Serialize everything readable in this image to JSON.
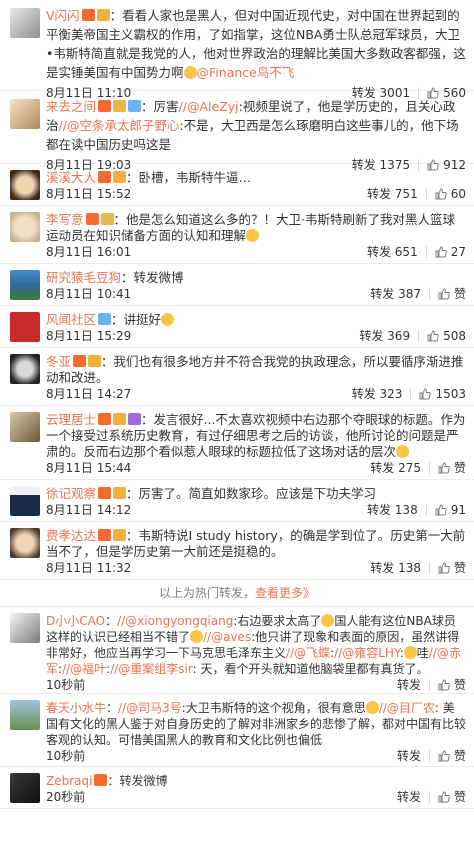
{
  "comments": [
    {
      "user": "V闪闪",
      "text": "：看看人家也是黑人，但对中国近现代史，对中国在世界起到的平衡美帝国主义霸权的作用，了如指掌，这位NBA勇士队总冠军球员，大卫•韦斯特简直就是我党的人，他对世界政治的理解比美国大多数政客都强，这是实锤美国有中国势力啊",
      "tail": "@Finance鸟不飞",
      "time": "8月11日 11:10",
      "repost": "转发 3001",
      "likes": "560"
    },
    {
      "user": "来去之间",
      "pre": "：厉害",
      "m1": "//@AleZyj",
      "t1": ":视频里说了，他是学历史的，且关心政治",
      "m2": "//@空条承太郎子野心",
      "t2": ":不是，大卫西是怎么琢磨明白这些事儿的，他下场都在读中国历史吗这是",
      "time": "8月11日 19:03",
      "repost": "转发 1375",
      "likes": "912"
    },
    {
      "user": "溪溪大人",
      "text": "：卧槽，韦斯特牛逼…",
      "time": "8月11日 15:52",
      "repost": "转发 751",
      "likes": "60"
    },
    {
      "user": "李写意",
      "text": "：他是怎么知道这么多的？！大卫·韦斯特刷新了我对黑人篮球运动员在知识储备方面的认知和理解",
      "time": "8月11日 16:01",
      "repost": "转发 651",
      "likes": "27"
    },
    {
      "user": "研究猿毛豆狗",
      "text": "：转发微博",
      "time": "8月11日 10:41",
      "repost": "转发 387",
      "likes": "赞"
    },
    {
      "user": "风闻社区",
      "text": "：讲挺好",
      "time": "8月11日 15:29",
      "repost": "转发 369",
      "likes": "508"
    },
    {
      "user": "冬亚",
      "text": "：我们也有很多地方并不符合我党的执政理念，所以要循序渐进推动和改进。",
      "time": "8月11日 14:27",
      "repost": "转发 323",
      "likes": "1503"
    },
    {
      "user": "云理居士",
      "text": "：发言很好...不太喜欢视频中右边那个夺眼球的标题。作为一个接受过系统历史教育，有过仔细思考之后的访谈，他所讨论的问题是严肃的。反而右边那个看似惹人眼球的标题拉低了这场对话的层次",
      "time": "8月11日 15:44",
      "repost": "转发 275",
      "likes": "赞"
    },
    {
      "user": "徐记观察",
      "text": "：厉害了。简直如数家珍。应该是下功夫学习",
      "time": "8月11日 14:12",
      "repost": "转发 138",
      "likes": "91"
    },
    {
      "user": "费孝达达",
      "text": "：韦斯特说I study history，的确是学到位了。历史第一大前当不了，但是学历史第一大前还是挺稳的。",
      "time": "8月11日 11:32",
      "repost": "转发 138",
      "likes": "赞"
    }
  ],
  "hotbar": {
    "text": "以上为热门转发，",
    "more": "查看更多》"
  },
  "recent": [
    {
      "user": "D小小CAO",
      "p1": "：",
      "m1": "//@xiongyongqiang",
      "t1": ":右边要求太高了",
      "t2": "国人能有这位NBA球员这样的认识已经相当不错了",
      "m2": "//@aves",
      "t3": ":他只讲了现象和表面的原因，虽然讲得非常好，他应当再学习一下马克思毛泽东主义",
      "m3": "//@飞蝶",
      "t4": ":",
      "m4": "//@雍容LHY",
      "t5": ":",
      "t6": "哇",
      "m5": "//@赤军",
      "t7": ":",
      "m6": "//@福叶",
      "t8": ":",
      "m7": "//@重案组李sir",
      "t9": ": 天，看个开头就知道他脑袋里都有真货了。",
      "time": "10秒前",
      "repost": "转发",
      "likes": "赞"
    },
    {
      "user": "春天小水牛",
      "p1": "：",
      "m1": "//@司马3号",
      "t1": ":大卫韦斯特的这个视角，很有意思",
      "m2": "//@目厂农",
      "t2": ": 美国有文化的黑人鉴于对自身历史的了解对非洲家乡的悲惨了解，都对中国有比较客观的认知。可惜美国黑人的教育和文化比例也偏低",
      "time": "10秒前",
      "repost": "转发",
      "likes": "赞"
    },
    {
      "user": "Zebraqi",
      "text": "：转发微博",
      "time": "20秒前",
      "repost": "转发",
      "likes": "赞"
    }
  ],
  "colors": {
    "accent": "#eb7350",
    "meta": "#333333",
    "divider": "#ebebeb"
  }
}
